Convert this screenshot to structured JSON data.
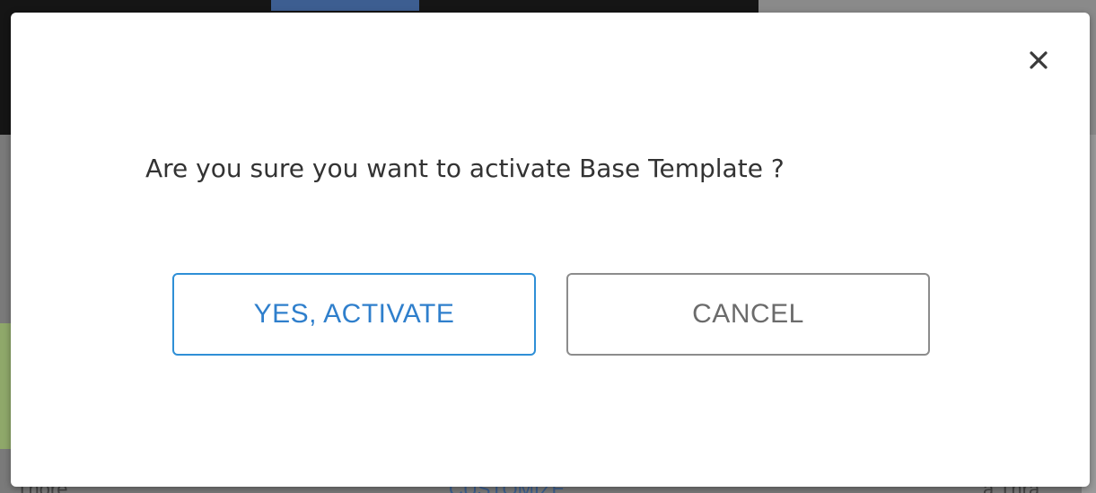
{
  "background": {
    "footer_left_text": "Thore",
    "footer_mid_text": "CUSTOMIZE",
    "footer_right_text": "a Thra"
  },
  "dialog": {
    "close_icon": "close-icon",
    "message": "Are you sure you want to activate Base Template ?",
    "confirm_label": "YES, ACTIVATE",
    "cancel_label": "CANCEL"
  },
  "colors": {
    "confirm_accent": "#2f8fd6",
    "cancel_border": "#8c8c8c",
    "text": "#333333"
  }
}
